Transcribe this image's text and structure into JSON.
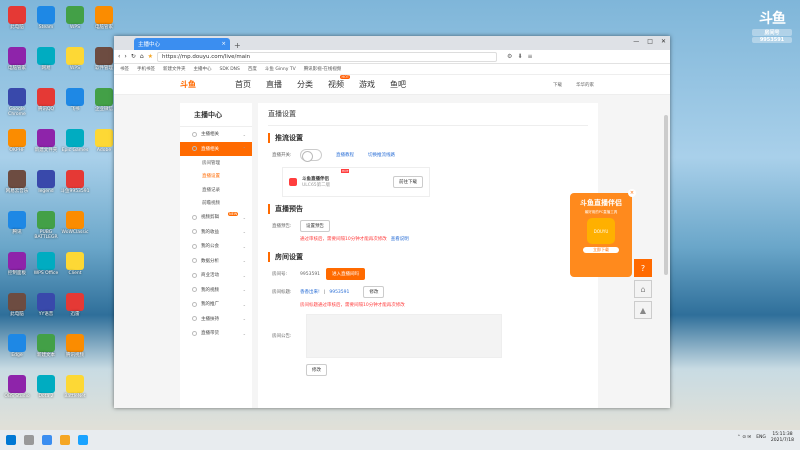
{
  "desktop": {
    "icons": [
      {
        "label": "此电脑",
        "x": 0,
        "y": 0
      },
      {
        "label": "Steam",
        "x": 1,
        "y": 0
      },
      {
        "label": "WPS",
        "x": 2,
        "y": 0
      },
      {
        "label": "电脑管家",
        "x": 3,
        "y": 0
      },
      {
        "label": "电脑管家",
        "x": 0,
        "y": 1
      },
      {
        "label": "网易",
        "x": 1,
        "y": 1
      },
      {
        "label": "WPS",
        "x": 2,
        "y": 1
      },
      {
        "label": "软件管理",
        "x": 3,
        "y": 1
      },
      {
        "label": "Google Chrome",
        "x": 0,
        "y": 2
      },
      {
        "label": "腾讯QQ",
        "x": 1,
        "y": 2
      },
      {
        "label": "飞书",
        "x": 2,
        "y": 2
      },
      {
        "label": "企业微信",
        "x": 3,
        "y": 2
      },
      {
        "label": "OKPHF",
        "x": 0,
        "y": 3
      },
      {
        "label": "新建文件夹",
        "x": 1,
        "y": 3
      },
      {
        "label": "Epic Games",
        "x": 2,
        "y": 3
      },
      {
        "label": "Adobe",
        "x": 3,
        "y": 3
      },
      {
        "label": "网易云音乐",
        "x": 0,
        "y": 4
      },
      {
        "label": "legend",
        "x": 1,
        "y": 4
      },
      {
        "label": "斗鱼9953591",
        "x": 2,
        "y": 4
      },
      {
        "label": "腾讯",
        "x": 0,
        "y": 5
      },
      {
        "label": "PUBG BATTLEGR",
        "x": 1,
        "y": 5
      },
      {
        "label": "WoWClassic",
        "x": 2,
        "y": 5
      },
      {
        "label": "控制面板",
        "x": 0,
        "y": 6
      },
      {
        "label": "WPS Office",
        "x": 1,
        "y": 6
      },
      {
        "label": "Client",
        "x": 2,
        "y": 6
      },
      {
        "label": "此电脑",
        "x": 0,
        "y": 7
      },
      {
        "label": "YY语音",
        "x": 1,
        "y": 7
      },
      {
        "label": "迅雷",
        "x": 2,
        "y": 7
      },
      {
        "label": "Edge",
        "x": 0,
        "y": 8
      },
      {
        "label": "新建文本",
        "x": 1,
        "y": 8
      },
      {
        "label": "腾讯视频",
        "x": 2,
        "y": 8
      },
      {
        "label": "OBS Studio",
        "x": 0,
        "y": 9
      },
      {
        "label": "Dota 2",
        "x": 1,
        "y": 9
      },
      {
        "label": "BattleNet",
        "x": 2,
        "y": 9
      }
    ]
  },
  "watermark": {
    "big": "斗鱼",
    "line1": "房间号",
    "line2": "9953591"
  },
  "browser": {
    "tab_title": "主播中心",
    "url": "https://mp.douyu.com/live/main",
    "bookmarks": [
      "书签",
      "手机书签",
      "新建文件夹",
      "主播中心",
      "SDK DNS",
      "百度",
      "斗鱼 Ginny TV",
      "腾讯影视-在线视频"
    ]
  },
  "nav": {
    "logo": "斗鱼",
    "items": [
      "首页",
      "直播",
      "分类",
      "视频",
      "游戏",
      "鱼吧"
    ],
    "hot": "HOT",
    "right": [
      "下载",
      "华华的家"
    ]
  },
  "sidebar": {
    "title": "主播中心",
    "items": [
      {
        "label": "主播相关"
      },
      {
        "label": "直播相关",
        "active": true
      },
      {
        "sub": "房间管理"
      },
      {
        "sub": "直播设置",
        "current": true
      },
      {
        "sub": "直播记录"
      },
      {
        "sub": "前瞻视频"
      },
      {
        "label": "视频剪辑",
        "new": "NEW"
      },
      {
        "label": "我的收益"
      },
      {
        "label": "我的公会"
      },
      {
        "label": "数据分析"
      },
      {
        "label": "商业活动"
      },
      {
        "label": "我的视频"
      },
      {
        "label": "我的推广"
      },
      {
        "label": "主播扶持"
      },
      {
        "label": "直播带货"
      }
    ]
  },
  "main": {
    "page_title": "直播设置",
    "push": {
      "title": "推流设置",
      "switch_label": "直播开关:",
      "link1": "直播教程",
      "link2": "切换推流线路"
    },
    "promo": {
      "title": "斗鱼直播伴侣",
      "sub": "ULC65第二版",
      "hot": "HOT",
      "btn": "前往下载"
    },
    "preview": {
      "title": "直播预告",
      "label": "直播预告:",
      "btn": "设置预告",
      "warn": "通过审核后，需要间隔10分钟才能再次修改",
      "link": "查看说明"
    },
    "room": {
      "title": "房间设置",
      "id_label": "房间号:",
      "id": "9953591",
      "id_btn": "进入直播间吗",
      "name_label": "房间标题:",
      "name_val": "香香出来!",
      "name_sep": "|",
      "name_id": "9953591",
      "name_btn": "修改",
      "warn": "房间标题通过审核后，需要间隔10分钟才能再次修改",
      "notice_label": "房间公告:",
      "notice_btn": "修改"
    }
  },
  "floatcard": {
    "title": "斗鱼直播伴侣",
    "sub": "最好用的PC直播工具",
    "app": "DOUYU",
    "btn": "立即下载",
    "close": "×"
  },
  "taskbar": {
    "lang": "ENG",
    "time": "15:11:38",
    "date": "2021/7/18"
  }
}
